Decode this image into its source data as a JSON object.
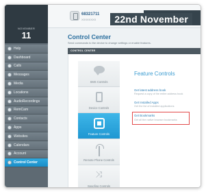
{
  "sidebar": {
    "date_month": "NOVEMBER",
    "date_day": "11",
    "items": [
      {
        "label": "Help",
        "active": false
      },
      {
        "label": "Dashboard",
        "active": false
      },
      {
        "label": "Calls",
        "active": false
      },
      {
        "label": "Messages",
        "active": false
      },
      {
        "label": "Media",
        "active": false
      },
      {
        "label": "Locations",
        "active": false
      },
      {
        "label": "AudioRecordings",
        "active": false
      },
      {
        "label": "RemCam",
        "active": false
      },
      {
        "label": "Contacts",
        "active": false
      },
      {
        "label": "Apps",
        "active": false
      },
      {
        "label": "Websites",
        "active": false
      },
      {
        "label": "Calendars",
        "active": false
      },
      {
        "label": "Account",
        "active": false
      },
      {
        "label": "Control Center",
        "active": true
      }
    ]
  },
  "header": {
    "device_id": "68321711",
    "device_sub": "XXXXXXXX",
    "date_label": "22nd November"
  },
  "page": {
    "title": "Control Center",
    "description": "Send commands to the device to change settings or enable features.",
    "section_label": "CONTROL CENTER"
  },
  "tabs": [
    {
      "label": "SMS Controls",
      "icon": "sms-bubble-icon",
      "active": false
    },
    {
      "label": "Device Controls",
      "icon": "device-icon",
      "active": false
    },
    {
      "label": "Feature Controls",
      "icon": "feature-icon",
      "active": true
    },
    {
      "label": "Remote Phone Controls",
      "icon": "tower-icon",
      "active": false
    },
    {
      "label": "Spoofing Controls",
      "icon": "shuffle-icon",
      "active": false
    }
  ],
  "feature": {
    "title": "Feature Controls",
    "links": [
      {
        "label": "Get latest address book",
        "sub": "Request a copy of the entire address book"
      },
      {
        "label": "Get Installed Apps",
        "sub": "Get the list of installed applications"
      },
      {
        "label": "Get Bookmarks",
        "sub": "Get all the native browser bookmarks"
      }
    ]
  },
  "colors": {
    "accent": "#1f97d2",
    "sidebar": "#5e6a73",
    "highlight": "#e24a4a"
  }
}
